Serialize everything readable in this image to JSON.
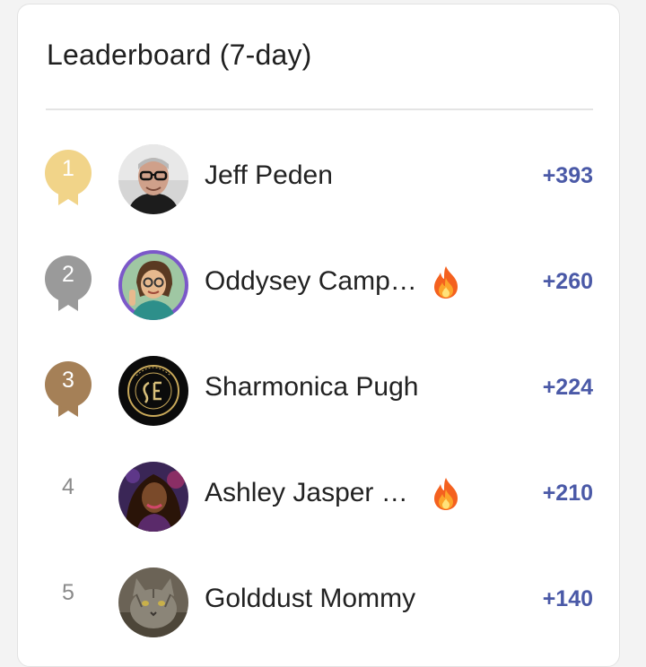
{
  "leaderboard": {
    "title": "Leaderboard (7-day)",
    "entries": [
      {
        "rank": "1",
        "name": "Jeff Peden",
        "score": "+393",
        "streak": false,
        "medal": "gold"
      },
      {
        "rank": "2",
        "name": "Oddysey Camp…",
        "score": "+260",
        "streak": true,
        "medal": "silver"
      },
      {
        "rank": "3",
        "name": "Sharmonica Pugh",
        "score": "+224",
        "streak": false,
        "medal": "bronze"
      },
      {
        "rank": "4",
        "name": "Ashley Jasper …",
        "score": "+210",
        "streak": true,
        "medal": "none"
      },
      {
        "rank": "5",
        "name": "Golddust Mommy",
        "score": "+140",
        "streak": false,
        "medal": "none"
      }
    ]
  },
  "colors": {
    "gold": "#f1d489",
    "silver": "#9a9a9a",
    "bronze": "#a58057",
    "score": "#4a59a7"
  },
  "icons": {
    "streak": "flame-icon",
    "medal": "ribbon-medal-icon"
  }
}
